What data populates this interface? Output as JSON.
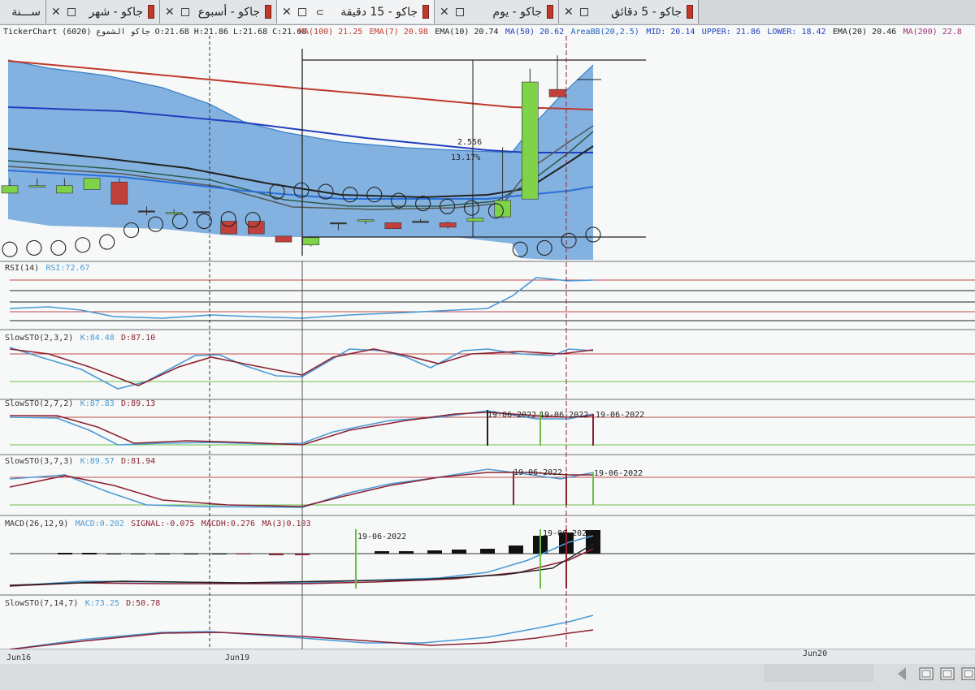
{
  "tabs": [
    {
      "label": "ســـنة",
      "active": false,
      "close": "",
      "has_color": false
    },
    {
      "label": "جاكو - شهر",
      "active": false,
      "close": "✕",
      "has_color": true
    },
    {
      "label": "جاكو - أسبوع",
      "active": false,
      "close": "✕",
      "has_color": true
    },
    {
      "label": "جاكو - 15 دقيقة",
      "active": true,
      "close": "✕",
      "has_color": true
    },
    {
      "label": "جاكو - يوم",
      "active": false,
      "close": "✕",
      "has_color": true
    },
    {
      "label": "جاكو - 5 دقائق",
      "active": false,
      "close": "✕",
      "has_color": true
    }
  ],
  "main_panel": {
    "ticker_label": "TickerChart (6020) جاكو الشموع O:21.68  H:21.86  L:21.68  C:21.68",
    "indicators": [
      {
        "name": "MA(100)",
        "value": "21.25",
        "color": "#c0392b"
      },
      {
        "name": "EMA(7)",
        "value": "20.98",
        "color": "#c0392b"
      },
      {
        "name": "EMA(10)",
        "value": "20.74",
        "color": "#222222"
      },
      {
        "name": "MA(50)",
        "value": "20.62",
        "color": "#1f3fbf"
      },
      {
        "name": "AreaBB(20,2.5)",
        "value": "",
        "color": "#1f5fbf"
      },
      {
        "name": "MID:",
        "value": "20.14",
        "color": "#1f3fbf"
      },
      {
        "name": "UPPER:",
        "value": "21.86",
        "color": "#1f3fbf"
      },
      {
        "name": "LOWER:",
        "value": "18.42",
        "color": "#1f3fbf"
      },
      {
        "name": "EMA(20)",
        "value": "20.46",
        "color": "#222222"
      },
      {
        "name": "MA(200)",
        "value": "22.8",
        "color": "#a0307a"
      }
    ],
    "measure_value": "2.556",
    "measure_percent": "13.17%",
    "candles": [
      {
        "o": 20.1,
        "h": 20.2,
        "l": 20.1,
        "c": 20.0,
        "color": "green"
      },
      {
        "o": 20.1,
        "h": 20.2,
        "l": 20.1,
        "c": 20.1,
        "color": "green"
      },
      {
        "o": 20.1,
        "h": 20.2,
        "l": 20.0,
        "c": 20.0,
        "color": "green"
      },
      {
        "o": 20.2,
        "h": 20.2,
        "l": 20.1,
        "c": 20.05,
        "color": "green"
      },
      {
        "o": 20.15,
        "h": 20.2,
        "l": 19.9,
        "c": 19.85,
        "color": "red"
      },
      {
        "o": 19.75,
        "h": 19.82,
        "l": 19.7,
        "c": 19.76,
        "color": "flat"
      },
      {
        "o": 19.72,
        "h": 19.78,
        "l": 19.7,
        "c": 19.74,
        "color": "green"
      },
      {
        "o": 19.75,
        "h": 19.76,
        "l": 19.75,
        "c": 19.75,
        "color": "flat"
      },
      {
        "o": 19.62,
        "h": 19.62,
        "l": 19.45,
        "c": 19.45,
        "color": "red"
      },
      {
        "o": 19.62,
        "h": 19.62,
        "l": 19.45,
        "c": 19.45,
        "color": "red"
      },
      {
        "o": 19.42,
        "h": 19.42,
        "l": 19.34,
        "c": 19.34,
        "color": "red"
      },
      {
        "o": 19.3,
        "h": 19.42,
        "l": 19.28,
        "c": 19.4,
        "color": "green"
      },
      {
        "o": 19.6,
        "h": 19.6,
        "l": 19.5,
        "c": 19.6,
        "color": "flat"
      },
      {
        "o": 19.62,
        "h": 19.65,
        "l": 19.58,
        "c": 19.64,
        "color": "green"
      },
      {
        "o": 19.6,
        "h": 19.6,
        "l": 19.52,
        "c": 19.52,
        "color": "red"
      },
      {
        "o": 19.62,
        "h": 19.65,
        "l": 19.6,
        "c": 19.62,
        "color": "flat"
      },
      {
        "o": 19.6,
        "h": 19.62,
        "l": 19.52,
        "c": 19.54,
        "color": "red"
      },
      {
        "o": 19.62,
        "h": 19.66,
        "l": 19.62,
        "c": 19.66,
        "color": "green"
      },
      {
        "o": 19.68,
        "h": 20.62,
        "l": 19.66,
        "c": 19.9,
        "color": "green"
      },
      {
        "o": 19.92,
        "h": 21.68,
        "l": 19.92,
        "c": 21.5,
        "color": "green"
      },
      {
        "o": 21.4,
        "h": 21.86,
        "l": 21.4,
        "c": 21.3,
        "color": "red"
      }
    ],
    "sar_dots": [
      19.24,
      19.26,
      19.26,
      19.3,
      19.34,
      19.5,
      19.58,
      19.62,
      19.62,
      19.65,
      19.64,
      20.02,
      20.04,
      20.02,
      19.98,
      19.98,
      19.9,
      19.86,
      19.82,
      19.8,
      19.76,
      19.24,
      19.26,
      19.36,
      19.44
    ],
    "x_labels": [
      {
        "label": "Jun16",
        "pos": 0
      },
      {
        "label": "Jun19",
        "pos": 1
      },
      {
        "label": "Jun20",
        "pos": 2
      }
    ]
  },
  "panels": [
    {
      "name": "rsi",
      "label": "RSI(14)",
      "values": [
        {
          "name": "RSI:",
          "value": "72.67"
        }
      ]
    },
    {
      "name": "slowsto-2-3-2",
      "label": "SlowSTO(2,3,2)",
      "values": [
        {
          "name": "K:",
          "value": "84.48"
        },
        {
          "name": "D:",
          "value": "87.10"
        }
      ]
    },
    {
      "name": "slowsto-2-7-2",
      "label": "SlowSTO(2,7,2)",
      "values": [
        {
          "name": "K:",
          "value": "87.83"
        },
        {
          "name": "D:",
          "value": "89.13"
        }
      ],
      "signals": [
        "19-06-2022",
        "19-06-2022",
        "19-06-2022"
      ]
    },
    {
      "name": "slowsto-3-7-3",
      "label": "SlowSTO(3,7,3)",
      "values": [
        {
          "name": "K:",
          "value": "89.57"
        },
        {
          "name": "D:",
          "value": "81.94"
        }
      ],
      "signals": [
        "19-06-2022",
        "19-06-2022"
      ]
    },
    {
      "name": "macd",
      "label": "MACD(26,12,9)",
      "values": [
        {
          "name": "MACD:",
          "value": "0.202"
        },
        {
          "name": "SIGNAL:",
          "value": "-0.075"
        },
        {
          "name": "MACDH:",
          "value": "0.276"
        },
        {
          "name": "MA(3)",
          "value": "0.103"
        }
      ],
      "signals": [
        "19-06-2022",
        "19-06-2022"
      ]
    },
    {
      "name": "slowsto-7-14-7",
      "label": "SlowSTO(7,14,7)",
      "values": [
        {
          "name": "K:",
          "value": "73.25"
        },
        {
          "name": "D:",
          "value": "50.78"
        }
      ]
    }
  ],
  "colors": {
    "band_fill": "#6ea6dc",
    "band_inner": "#4f8fd0",
    "candle_green": "#7ed348",
    "candle_red": "#c2403a",
    "ma_red": "#c0392b",
    "ma_blue": "#1f3fbf",
    "k_line": "#4a9ad6",
    "d_line": "#8b2232",
    "level_red": "#c04a4a",
    "level_green": "#6cc04a"
  },
  "footer_icons": [
    "window-restore-icon",
    "window-tile-icon",
    "window-cascade-icon"
  ]
}
